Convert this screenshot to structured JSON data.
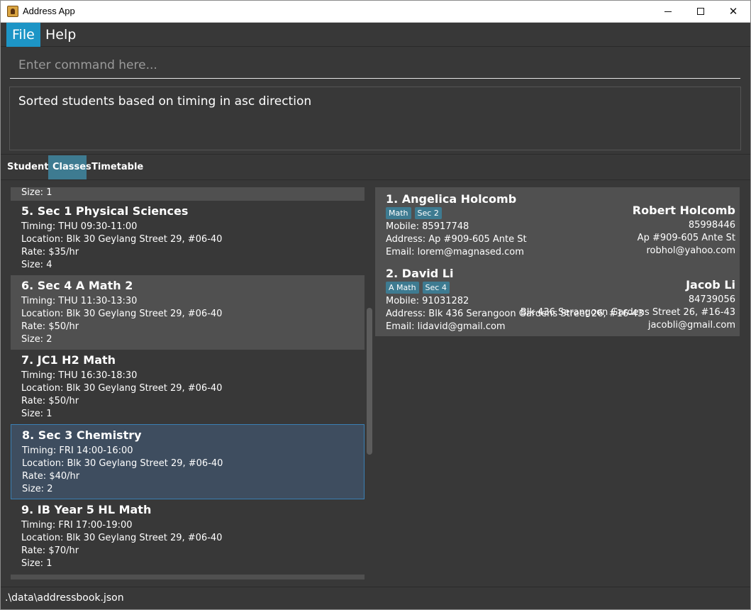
{
  "window": {
    "title": "Address App"
  },
  "menu": {
    "file": "File",
    "help": "Help"
  },
  "command": {
    "placeholder": "Enter command here..."
  },
  "result": {
    "text": "Sorted students based on timing in asc direction"
  },
  "tabs": {
    "students": "Students",
    "classes": "Classes",
    "timetable": "Timetable"
  },
  "classes": {
    "partial_size": "Size: 1",
    "items": [
      {
        "title": "5.  Sec 1 Physical Sciences",
        "timing": "Timing: THU 09:30-11:00",
        "location": "Location: Blk 30 Geylang Street 29, #06-40",
        "rate": "Rate: $35/hr",
        "size": "Size: 4"
      },
      {
        "title": "6.  Sec 4 A Math 2",
        "timing": "Timing: THU 11:30-13:30",
        "location": "Location: Blk 30 Geylang Street 29, #06-40",
        "rate": "Rate: $50/hr",
        "size": "Size: 2"
      },
      {
        "title": "7.  JC1 H2 Math",
        "timing": "Timing: THU 16:30-18:30",
        "location": "Location: Blk 30 Geylang Street 29, #06-40",
        "rate": "Rate: $50/hr",
        "size": "Size: 1"
      },
      {
        "title": "8.  Sec 3 Chemistry",
        "timing": "Timing: FRI 14:00-16:00",
        "location": "Location: Blk 30 Geylang Street 29, #06-40",
        "rate": "Rate: $40/hr",
        "size": "Size: 2"
      },
      {
        "title": "9.  IB Year 5 HL Math",
        "timing": "Timing: FRI 17:00-19:00",
        "location": "Location: Blk 30 Geylang Street 29, #06-40",
        "rate": "Rate: $70/hr",
        "size": "Size: 1"
      }
    ]
  },
  "students": [
    {
      "name": "1.  Angelica Holcomb",
      "tags": [
        "Math",
        "Sec 2"
      ],
      "mobile": "Mobile: 85917748",
      "address": "Address: Ap #909-605 Ante St",
      "email": "Email: lorem@magnased.com",
      "parent_name": "Robert Holcomb",
      "parent_phone": "85998446",
      "parent_address": "Ap #909-605 Ante St",
      "parent_email": "robhol@yahoo.com"
    },
    {
      "name": "2.  David Li",
      "tags": [
        "A Math",
        "Sec 4"
      ],
      "mobile": "Mobile: 91031282",
      "address": "Address: Blk 436 Serangoon Gardens Street 26, #16-43",
      "email": "Email: lidavid@gmail.com",
      "parent_name": "Jacob Li",
      "parent_phone": "84739056",
      "parent_address": "Blk 436 Serangoon Gardens Street 26, #16-43",
      "parent_email": "jacobli@gmail.com"
    }
  ],
  "status": {
    "path": ".\\data\\addressbook.json"
  }
}
